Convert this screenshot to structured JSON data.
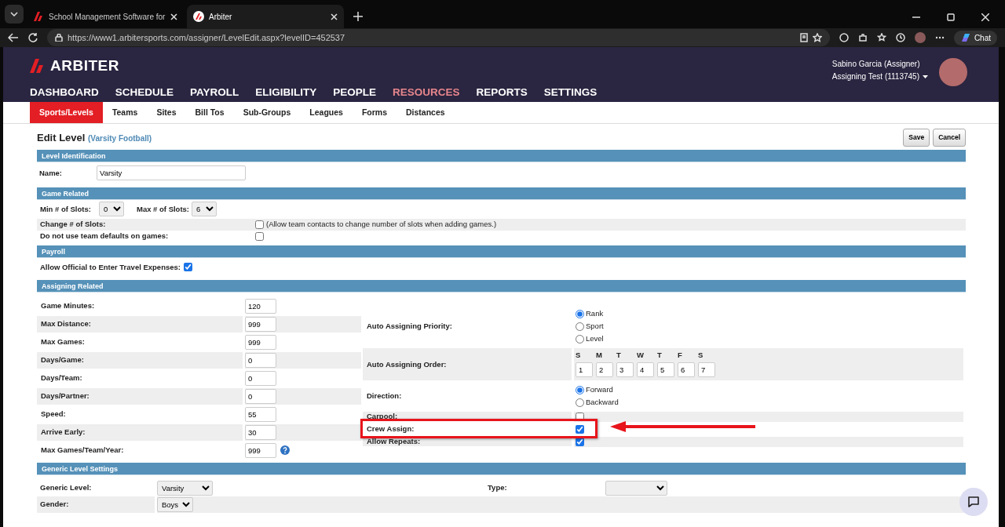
{
  "browser": {
    "tabs": [
      {
        "title": "School Management Software for",
        "selected": false
      },
      {
        "title": "Arbiter",
        "selected": true
      }
    ],
    "url": "https://www1.arbitersports.com/assigner/LevelEdit.aspx?levelID=452537",
    "chat_label": "Chat"
  },
  "header": {
    "logo": "ARBITER",
    "nav": [
      {
        "label": "DASHBOARD",
        "selected": false
      },
      {
        "label": "SCHEDULE",
        "selected": false
      },
      {
        "label": "PAYROLL",
        "selected": false
      },
      {
        "label": "ELIGIBILITY",
        "selected": false
      },
      {
        "label": "PEOPLE",
        "selected": false
      },
      {
        "label": "RESOURCES",
        "selected": true
      },
      {
        "label": "REPORTS",
        "selected": false
      },
      {
        "label": "SETTINGS",
        "selected": false
      }
    ],
    "user": "Sabino Garcia (Assigner)",
    "account": "Assigning Test (1113745)"
  },
  "subnav": [
    {
      "label": "Sports/Levels",
      "selected": true
    },
    {
      "label": "Teams",
      "selected": false
    },
    {
      "label": "Sites",
      "selected": false
    },
    {
      "label": "Bill Tos",
      "selected": false
    },
    {
      "label": "Sub-Groups",
      "selected": false
    },
    {
      "label": "Leagues",
      "selected": false
    },
    {
      "label": "Forms",
      "selected": false
    },
    {
      "label": "Distances",
      "selected": false
    }
  ],
  "page": {
    "title": "Edit Level",
    "subtitle": "(Varsity Football)",
    "buttons": [
      "Save",
      "Cancel"
    ]
  },
  "level_identification": {
    "heading": "Level Identification",
    "name_label": "Name:",
    "name_value": "Varsity"
  },
  "game_related": {
    "heading": "Game Related",
    "min_label": "Min # of Slots:",
    "min_value": "0",
    "max_label": "Max # of Slots:",
    "max_value": "6",
    "rows": [
      {
        "label": "Change # of Slots:",
        "checked": false,
        "note": "(Allow team contacts to change number of slots when adding games.)"
      },
      {
        "label": "Do not use team defaults on games:",
        "checked": false
      }
    ]
  },
  "payroll": {
    "heading": "Payroll",
    "label": "Allow Official to Enter Travel Expenses:",
    "checked": true
  },
  "assigning_related": {
    "heading": "Assigning Related",
    "fields": [
      {
        "label": "Game Minutes:",
        "value": "120"
      },
      {
        "label": "Max Distance:",
        "value": "999"
      },
      {
        "label": "Max Games:",
        "value": "999"
      },
      {
        "label": "Days/Game:",
        "value": "0"
      },
      {
        "label": "Days/Team:",
        "value": "0"
      },
      {
        "label": "Days/Partner:",
        "value": "0"
      },
      {
        "label": "Speed:",
        "value": "55"
      },
      {
        "label": "Arrive Early:",
        "value": "30"
      },
      {
        "label": "Max Games/Team/Year:",
        "value": "999",
        "help": true
      }
    ],
    "options": [
      {
        "kind": "radio",
        "label": "Auto Assigning Priority:",
        "choices": [
          {
            "label": "Rank",
            "selected": true
          },
          {
            "label": "Sport",
            "selected": false
          },
          {
            "label": "Level",
            "selected": false
          }
        ]
      },
      {
        "kind": "order",
        "label": "Auto Assigning Order:",
        "days": [
          {
            "day": "S",
            "value": "1"
          },
          {
            "day": "M",
            "value": "2"
          },
          {
            "day": "T",
            "value": "3"
          },
          {
            "day": "W",
            "value": "4"
          },
          {
            "day": "T",
            "value": "5"
          },
          {
            "day": "F",
            "value": "6"
          },
          {
            "day": "S",
            "value": "7"
          }
        ]
      },
      {
        "kind": "radio",
        "label": "Direction:",
        "choices": [
          {
            "label": "Forward",
            "selected": true
          },
          {
            "label": "Backward",
            "selected": false
          }
        ]
      },
      {
        "kind": "checkbox",
        "label": "Carpool:",
        "checked": false
      },
      {
        "kind": "checkbox",
        "label": "Crew Assign:",
        "checked": true,
        "highlighted": true
      },
      {
        "kind": "checkbox",
        "label": "Allow Repeats:",
        "checked": true
      }
    ]
  },
  "generic_level_settings": {
    "heading": "Generic Level Settings",
    "rows": [
      {
        "label": "Generic Level:",
        "value": "Varsity"
      },
      {
        "label": "Gender:",
        "value": "Boys"
      }
    ],
    "type_label": "Type:"
  }
}
